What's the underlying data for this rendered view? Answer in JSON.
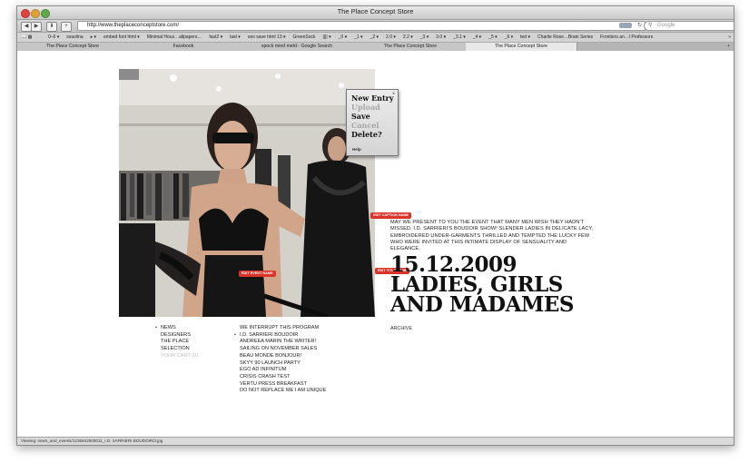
{
  "browser": {
    "title": "The Place Concept Store",
    "url": "http://www.theplaceconceptstore.com/",
    "search_placeholder": "Google",
    "bookmarks": [
      "0–0 ▾",
      "ssaolina",
      "▸ ▾",
      "embed font html ▾",
      "Minimal Hous…allpapers…",
      "fast2 ▾",
      "last ▾",
      "seo save html 13 ▾",
      "GreenSock",
      "|||| ▾",
      "_0 ▾",
      "_1 ▾",
      "_2 ▾",
      "2.0 ▾",
      "2.2 ▾",
      "_3 ▾",
      "3.0 ▾",
      "_3.1 ▾",
      "_4 ▾",
      "_5 ▾",
      "_6 ▾",
      "ted ▾",
      "Charlie Rose…Brain Series",
      "Frontiers an…l Professors"
    ],
    "tabs": [
      "The Place Concept Store",
      "Facebook",
      "spock mind meld - Google Search",
      "The Place Concept Store",
      "The Place Concept Store"
    ],
    "status": "Viewing: news_and_events/1235842500011_I.D. SARRIERI BOUDOIR/3.jpg"
  },
  "popup": {
    "items": [
      "New Entry",
      "Upload",
      "Save",
      "Cancel",
      "Delete?"
    ],
    "help": "Help",
    "close": "x"
  },
  "tags": {
    "caption": "EDIT CAPTION NAME",
    "event": "EDIT EVENT NAME",
    "title": "EDIT TITLE NAME"
  },
  "caption": "MAY WE PRESENT TO YOU THE EVENT THAT MANY MEN WISH THEY HADN'T MISSED. I.D. SARRIERI'S BOUDOIR SHOW! SLENDER LADIES IN DELICATE LACY, EMBROIDERED UNDER-GARMENTS THRILLED AND TEMPTED THE LUCKY FEW WHO WERE INVITED AT THIS INTIMATE DISPLAY OF SENSUALITY AND ELEGANCE.",
  "headline": {
    "date": "15.12.2009",
    "line1": "LADIES, GIRLS",
    "line2": "AND MADAMES"
  },
  "archive": "ARCHIVE",
  "nav": [
    "NEWS",
    "DESIGNERS",
    "THE PLACE",
    "SELECTION",
    "YOUR CART (0)"
  ],
  "events": [
    "WE INTERRUPT THIS PROGRAM",
    "I.D. SARRIERI BOUDOIR",
    "ANDREEA MARIN THE WRITER!",
    "SAILING ON NOVEMBER SALES",
    "BEAU MONDE BONJOUR!",
    "SKYY 90 LAUNCH PARTY",
    "EGO AD INFINITUM",
    "CRISIS CRASH TEST",
    "VERTU PRESS BREAKFAST",
    "DO NOT REPLACE ME I AM UNIQUE"
  ]
}
